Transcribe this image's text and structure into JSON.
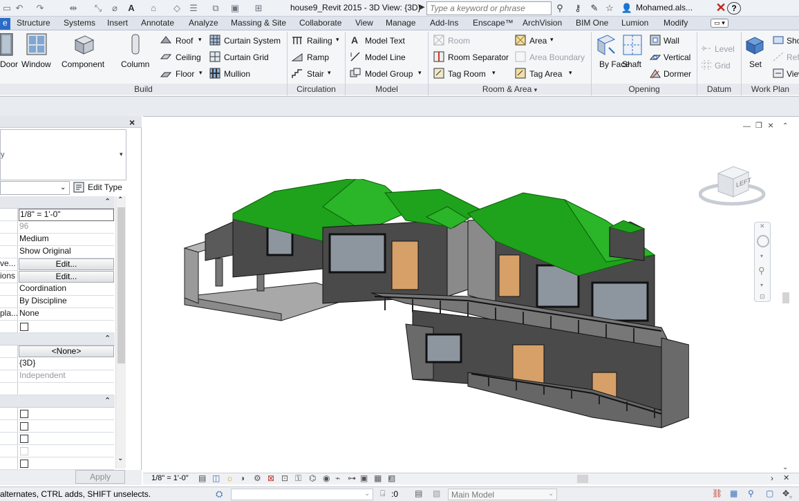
{
  "app": {
    "title": "house9_Revit 2015 - 3D View: {3D}",
    "search_placeholder": "Type a keyword or phrase",
    "user": "Mohamed.als..."
  },
  "tabs": [
    {
      "label": "e",
      "active": true
    },
    {
      "label": "Structure"
    },
    {
      "label": "Systems"
    },
    {
      "label": "Insert"
    },
    {
      "label": "Annotate"
    },
    {
      "label": "Analyze"
    },
    {
      "label": "Massing & Site"
    },
    {
      "label": "Collaborate"
    },
    {
      "label": "View"
    },
    {
      "label": "Manage"
    },
    {
      "label": "Add-Ins"
    },
    {
      "label": "Enscape™"
    },
    {
      "label": "ArchVision"
    },
    {
      "label": "BIM One"
    },
    {
      "label": "Lumion"
    },
    {
      "label": "Modify"
    }
  ],
  "ribbon": {
    "build": {
      "label": "Build",
      "door": "Door",
      "window": "Window",
      "component": "Component",
      "column": "Column",
      "roof": "Roof",
      "ceiling": "Ceiling",
      "floor": "Floor",
      "curtain_system": "Curtain System",
      "curtain_grid": "Curtain Grid",
      "mullion": "Mullion"
    },
    "circulation": {
      "label": "Circulation",
      "railing": "Railing",
      "ramp": "Ramp",
      "stair": "Stair"
    },
    "model": {
      "label": "Model",
      "model_text": "Model Text",
      "model_line": "Model Line",
      "model_group": "Model Group"
    },
    "room_area": {
      "label": "Room & Area",
      "room": "Room",
      "room_separator": "Room Separator",
      "tag_room": "Tag Room",
      "area": "Area",
      "area_boundary": "Area Boundary",
      "tag_area": "Tag Area"
    },
    "opening": {
      "label": "Opening",
      "by_face": "By Face",
      "shaft": "Shaft",
      "wall": "Wall",
      "vertical": "Vertical",
      "dormer": "Dormer"
    },
    "datum": {
      "label": "Datum",
      "level": "Level",
      "grid": "Grid"
    },
    "work_plane": {
      "label": "Work Plan",
      "set": "Set",
      "show": "Sho",
      "ref": "Ref",
      "viewer": "View"
    }
  },
  "properties": {
    "type_label": "Edit Type",
    "rows": [
      {
        "label": "",
        "value": "1/8\" = 1'-0\"",
        "kind": "input"
      },
      {
        "label": "",
        "value": "96",
        "kind": "disabled"
      },
      {
        "label": "",
        "value": "Medium",
        "kind": "text"
      },
      {
        "label": "",
        "value": "Show Original",
        "kind": "text"
      },
      {
        "label": "ve...",
        "value": "Edit...",
        "kind": "button"
      },
      {
        "label": "ions",
        "value": "Edit...",
        "kind": "button"
      },
      {
        "label": "",
        "value": "Coordination",
        "kind": "text"
      },
      {
        "label": "",
        "value": "By Discipline",
        "kind": "text"
      },
      {
        "label": "pla...",
        "value": "None",
        "kind": "text"
      }
    ],
    "rows2": [
      {
        "label": "",
        "value": "<None>",
        "kind": "button"
      },
      {
        "label": "",
        "value": "{3D}",
        "kind": "text"
      },
      {
        "label": "",
        "value": "Independent",
        "kind": "disabled"
      }
    ],
    "apply_label": "Apply"
  },
  "view_control": {
    "scale": "1/8\" = 1'-0\""
  },
  "status": {
    "message": "alternates, CTRL adds, SHIFT unselects.",
    "selection_count": ":0",
    "model": "Main Model"
  },
  "viewcube": {
    "face": "LEFT"
  },
  "colors": {
    "roof": "#1fa21c",
    "wall": "#4a4a4a",
    "accent": "#2a6cc7",
    "door": "#d6a068"
  }
}
